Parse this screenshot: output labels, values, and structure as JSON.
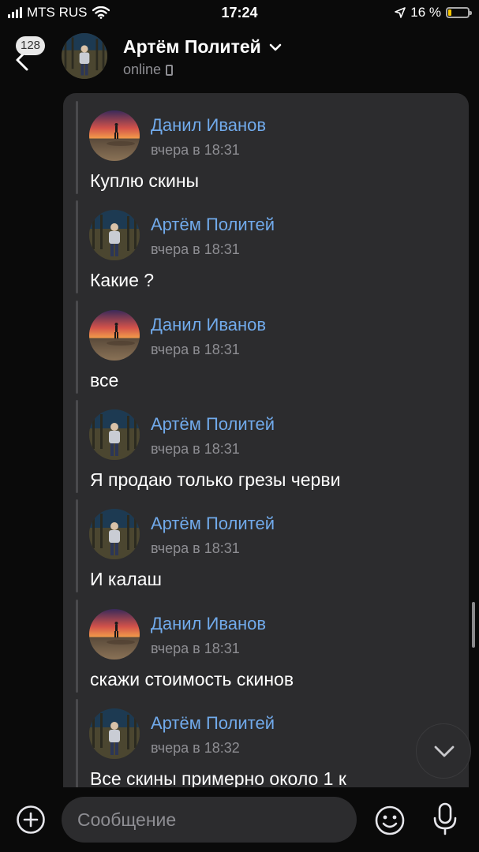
{
  "status_bar": {
    "carrier": "MTS RUS",
    "time": "17:24",
    "battery_text": "16 %",
    "battery_level": 0.16
  },
  "header": {
    "unread_count": "128",
    "contact_name": "Артём Политей",
    "status": "online"
  },
  "messages": [
    {
      "author": "Данил Иванов",
      "time": "вчера в 18:31",
      "text": "Куплю скины",
      "avatar": "sunset-avatar"
    },
    {
      "author": "Артём Политей",
      "time": "вчера в 18:31",
      "text": "Какие ?",
      "avatar": "person-avatar"
    },
    {
      "author": "Данил Иванов",
      "time": "вчера в 18:31",
      "text": "все",
      "avatar": "sunset-avatar"
    },
    {
      "author": "Артём Политей",
      "time": "вчера в 18:31",
      "text": "Я продаю только грезы черви",
      "avatar": "person-avatar"
    },
    {
      "author": "Артём Политей",
      "time": "вчера в 18:31",
      "text": "И калаш",
      "avatar": "person-avatar"
    },
    {
      "author": "Данил Иванов",
      "time": "вчера в 18:31",
      "text": "скажи стоимость скинов",
      "avatar": "sunset-avatar"
    },
    {
      "author": "Артём Политей",
      "time": "вчера в 18:32",
      "text": "Все скины примерно около 1 к",
      "avatar": "person-avatar"
    }
  ],
  "composer": {
    "placeholder": "Сообщение"
  },
  "colors": {
    "background": "#0a0a0a",
    "bubble": "#2c2c2e",
    "author_name": "#71aaeb",
    "secondary_text": "#8e8e93",
    "battery": "#f7c600"
  }
}
